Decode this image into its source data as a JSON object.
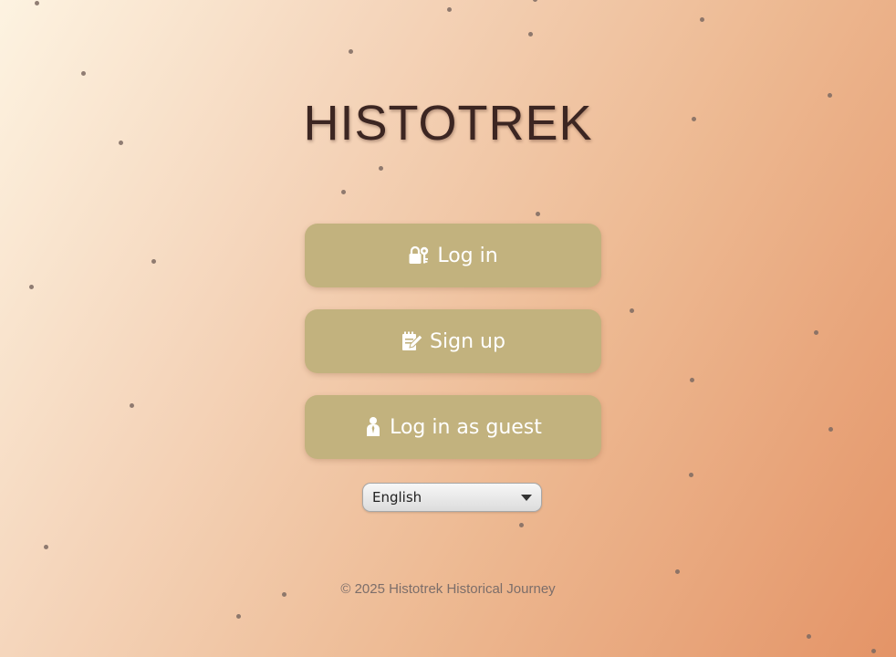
{
  "app": {
    "title": "HISTOTREK"
  },
  "menu": {
    "login_label": "Log in",
    "signup_label": "Sign up",
    "guest_label": "Log in as guest"
  },
  "language": {
    "selected": "English"
  },
  "footer": {
    "copyright": "© 2025 Histotrek Historical Journey"
  },
  "icons": {
    "login": "lock-key-icon",
    "signup": "notepad-pencil-icon",
    "guest": "person-icon",
    "dropdown": "chevron-down-icon"
  },
  "colors": {
    "title": "#3c2622",
    "button": "#c2b27e",
    "button_text": "#ffffff",
    "footer_text": "#7c6e6a",
    "background_start": "#fdf3e1",
    "background_end": "#e49467"
  }
}
